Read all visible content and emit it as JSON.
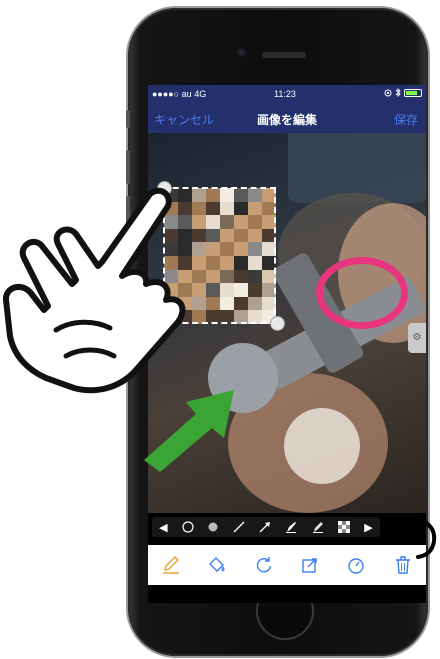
{
  "status_bar": {
    "carrier": "●●●●○ au  4G",
    "time": "11:23",
    "battery_color": "#7fff4a"
  },
  "nav": {
    "cancel_label": "キャンセル",
    "title": "画像を編集",
    "save_label": "保存",
    "bar_color": "#23306b",
    "accent_color": "#4d7bf0"
  },
  "annotations": {
    "circle_color": "#e8357f",
    "arrow_color": "#3aa534"
  },
  "tool_strip": {
    "items": [
      "left-arrow-icon",
      "hollow-circle-icon",
      "filled-circle-icon",
      "line-icon",
      "arrow-tool-icon",
      "marker-icon",
      "highlighter-icon",
      "mosaic-icon",
      "right-arrow-icon"
    ]
  },
  "bottom_toolbar": {
    "items": [
      "pencil-icon",
      "paint-bucket-icon",
      "rotate-icon",
      "crop-icon",
      "timer-icon",
      "trash-icon"
    ],
    "active_color": "#e8a32a",
    "icon_color": "#3c7ff0"
  }
}
